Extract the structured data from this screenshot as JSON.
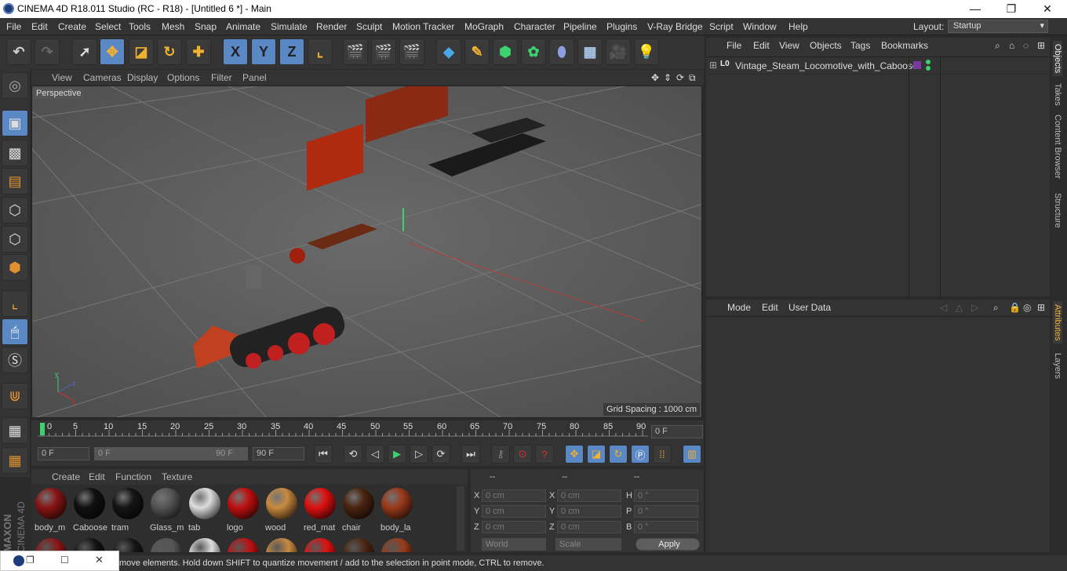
{
  "window": {
    "title": "CINEMA 4D R18.011 Studio (RC - R18) - [Untitled 6 *] - Main",
    "controls": [
      "—",
      "❐",
      "✕"
    ]
  },
  "menubar": {
    "items": [
      "File",
      "Edit",
      "Create",
      "Select",
      "Tools",
      "Mesh",
      "Snap",
      "Animate",
      "Simulate",
      "Render",
      "Sculpt",
      "Motion Tracker",
      "MoGraph",
      "Character",
      "Pipeline",
      "Plugins",
      "V-Ray Bridge",
      "Script",
      "Window",
      "Help"
    ],
    "layout_label": "Layout:",
    "layout_value": "Startup"
  },
  "toolbar": {
    "axis_x": "X",
    "axis_y": "Y",
    "axis_z": "Z"
  },
  "viewport": {
    "menu": [
      "View",
      "Cameras",
      "Display",
      "Options",
      "Filter",
      "Panel"
    ],
    "label": "Perspective",
    "grid_spacing": "Grid Spacing : 1000 cm",
    "axis_x": "x",
    "axis_y": "y",
    "axis_z": "z"
  },
  "timeline": {
    "ticks": [
      "0",
      "5",
      "10",
      "15",
      "20",
      "25",
      "30",
      "35",
      "40",
      "45",
      "50",
      "55",
      "60",
      "65",
      "70",
      "75",
      "80",
      "85",
      "90"
    ],
    "current_frame": "0 F",
    "start": "0 F",
    "range_start": "0 F",
    "range_end": "90 F",
    "end": "90 F"
  },
  "materials": {
    "menu": [
      "Create",
      "Edit",
      "Function",
      "Texture"
    ],
    "items": [
      {
        "name": "body_m",
        "color": "#8a1515"
      },
      {
        "name": "Caboose",
        "color": "#111111"
      },
      {
        "name": "tram",
        "color": "#151515"
      },
      {
        "name": "Glass_m",
        "color": "#555555"
      },
      {
        "name": "tab",
        "color": "#dddddd"
      },
      {
        "name": "logo",
        "color": "#c01010"
      },
      {
        "name": "wood",
        "color": "#c98a3e"
      },
      {
        "name": "red_mat",
        "color": "#e01010"
      },
      {
        "name": "chair",
        "color": "#4a2410"
      },
      {
        "name": "body_la",
        "color": "#9a3a1a"
      }
    ]
  },
  "coords": {
    "headers": [
      "--",
      "--",
      "--"
    ],
    "rows": [
      {
        "a": "X",
        "av": "0 cm",
        "b": "X",
        "bv": "0 cm",
        "c": "H",
        "cv": "0 °"
      },
      {
        "a": "Y",
        "av": "0 cm",
        "b": "Y",
        "bv": "0 cm",
        "c": "P",
        "cv": "0 °"
      },
      {
        "a": "Z",
        "av": "0 cm",
        "b": "Z",
        "bv": "0 cm",
        "c": "B",
        "cv": "0 °"
      }
    ],
    "world": "World",
    "scale": "Scale",
    "apply": "Apply"
  },
  "objects": {
    "menu": [
      "File",
      "Edit",
      "View",
      "Objects",
      "Tags",
      "Bookmarks"
    ],
    "item": "Vintage_Steam_Locomotive_with_Caboose",
    "layer": "L0"
  },
  "attributes": {
    "menu": [
      "Mode",
      "Edit",
      "User Data"
    ]
  },
  "sidetabs": [
    "Objects",
    "Takes",
    "Content Browser",
    "Structure",
    "Attributes",
    "Layers"
  ],
  "brand": {
    "line1": "MAXON",
    "line2": "CINEMA 4D"
  },
  "status": "move elements. Hold down SHIFT to quantize movement / add to the selection in point mode, CTRL to remove.",
  "colors": {
    "accent": "#5a88c4",
    "timeline_marker": "#3bd16f"
  }
}
